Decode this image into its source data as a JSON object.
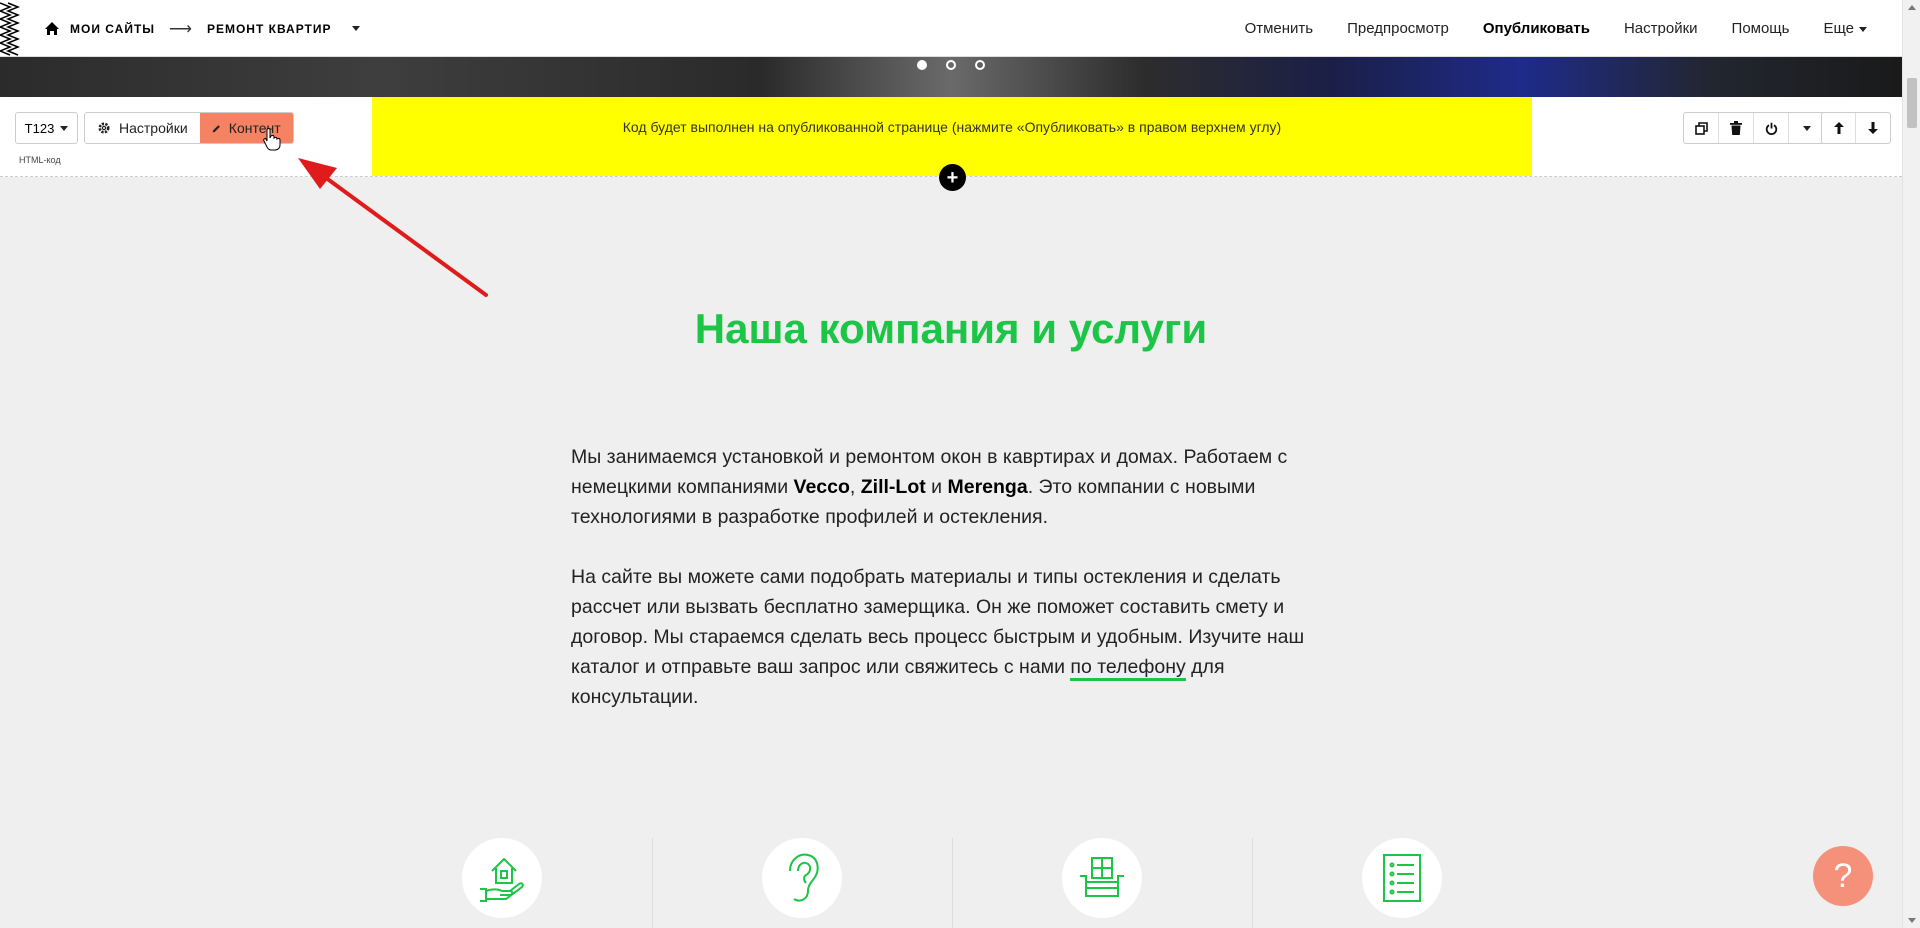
{
  "header": {
    "breadcrumb_home": "МОИ САЙТЫ",
    "breadcrumb_arrow": "⟶",
    "breadcrumb_project": "РЕМОНТ КВАРТИР",
    "nav": {
      "undo": "Отменить",
      "preview": "Предпросмотр",
      "publish": "Опубликовать",
      "settings": "Настройки",
      "help": "Помощь",
      "more": "Еще"
    }
  },
  "slider": {
    "dots": 3,
    "active_index": 0
  },
  "block": {
    "type_label": "T123",
    "settings_label": "Настройки",
    "content_label": "Контент",
    "block_name": "HTML-код",
    "notice": "Код будет выполнен на опубликованной странице (нажмите «Опубликовать» в правом верхнем углу)",
    "add_symbol": "+"
  },
  "section": {
    "title": "Наша компания и услуги",
    "p1_a": "Мы занимаемся установкой и ремонтом окон в кавртирах и домах. Работаем с немецкими компаниями ",
    "brand1": "Vecco",
    "comma": ", ",
    "brand2": "Zill-Lot",
    "and": " и ",
    "brand3": "Merenga",
    "p1_b": ". Это компании с новыми технологиями в разработке профилей и остекления.",
    "p2_a": "На сайте вы можете сами подобрать материалы и типы остекления и сделать рассчет или вызвать бесплатно замерщика. Он же поможет составить смету и договор. Мы стараемся сделать весь процесс быстрым и удобным. Изучите наш каталог и отправьте ваш запрос или свяжитесь с нами ",
    "p2_link": "по телефону",
    "p2_b": " для консультации."
  },
  "features_icons": [
    "house-hand-icon",
    "ear-icon",
    "building-box-icon",
    "checklist-icon"
  ],
  "help_button": "?",
  "colors": {
    "accent_green": "#1cc545",
    "content_button": "#f58363",
    "notice_bg": "#ffff00",
    "help_button": "#f5907a",
    "annotation_arrow": "#e01b1b"
  }
}
